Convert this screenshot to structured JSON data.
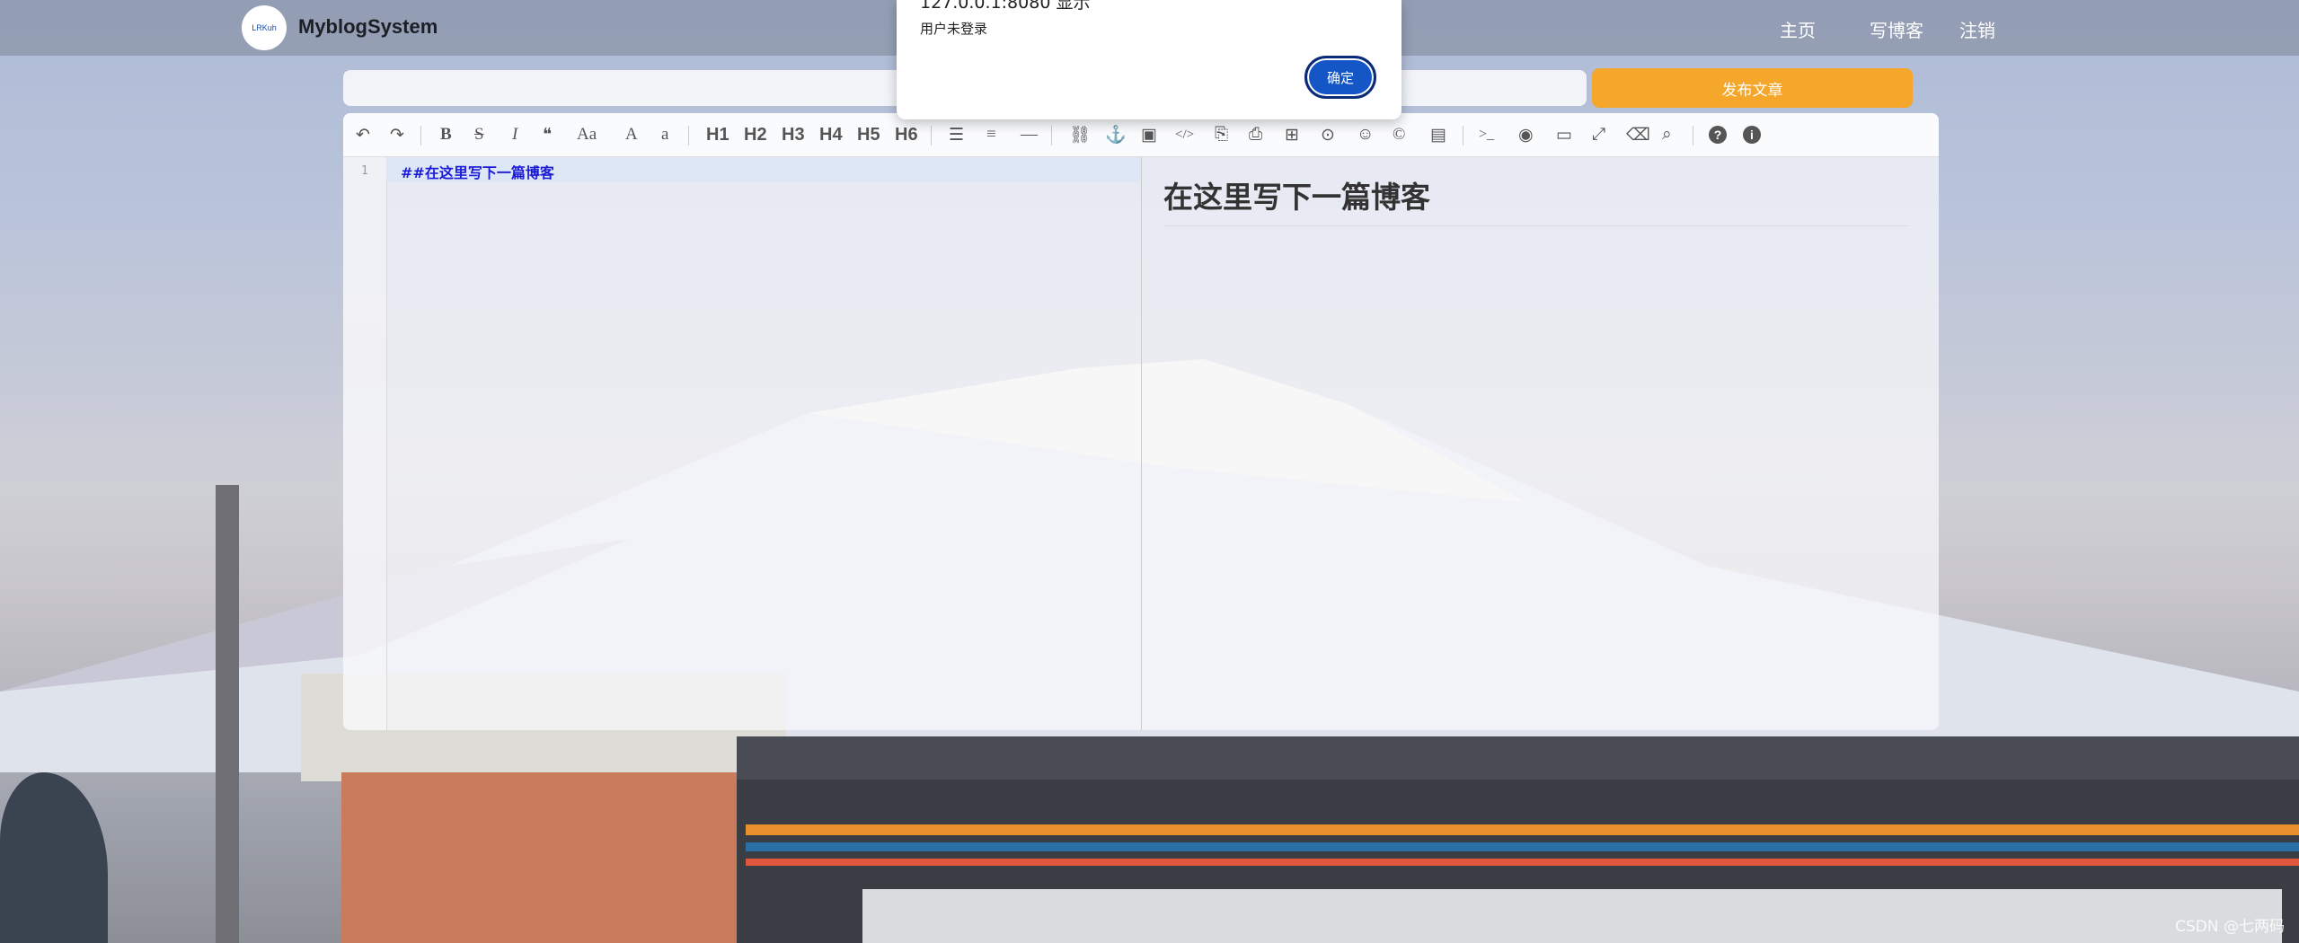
{
  "navbar": {
    "logo_text": "LRKuh",
    "brand": "MyblogSystem",
    "links": [
      "主页",
      "写博客",
      "注销"
    ]
  },
  "title_row": {
    "input_value": "",
    "publish_label": "发布文章"
  },
  "toolbar": {
    "undo": "↶",
    "redo": "↷",
    "bold": "B",
    "strike": "S",
    "italic": "I",
    "quote": "❝",
    "uppercase": "Aa",
    "upper": "A",
    "lower": "a",
    "h1": "H1",
    "h2": "H2",
    "h3": "H3",
    "h4": "H4",
    "h5": "H5",
    "h6": "H6",
    "ul": "☰",
    "ol": "≡",
    "hr": "—",
    "link": "⛓",
    "anchor": "⚓",
    "image": "▣",
    "code": "</>",
    "code_block": "⎘",
    "pre": "⎙",
    "table": "⊞",
    "datetime": "⊙",
    "emoji": "☺",
    "html_entity": "©",
    "pagebreak": "▤",
    "goto_line": ">_",
    "watch": "◉",
    "preview": "▭",
    "fullscreen": "⤢",
    "clear": "⌫",
    "search": "⌕",
    "help": "?",
    "info": "i"
  },
  "editor": {
    "line_number": "1",
    "content": "##在这里写下一篇博客",
    "preview_heading": "在这里写下一篇博客"
  },
  "dialog": {
    "title": "127.0.0.1:8080 显示",
    "message": "用户未登录",
    "ok_label": "确定"
  },
  "watermark": "CSDN @七两码"
}
